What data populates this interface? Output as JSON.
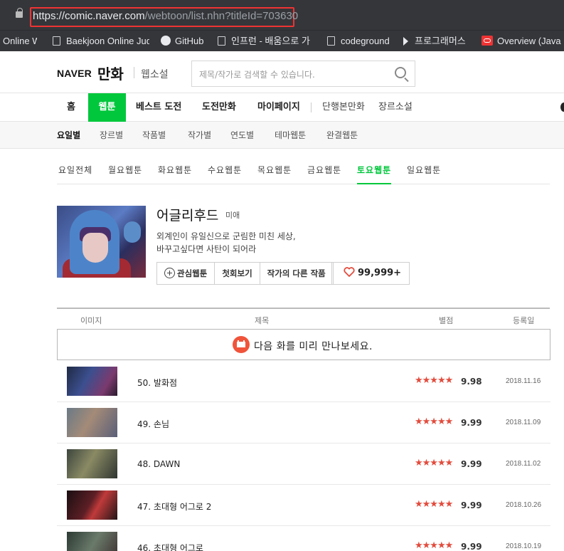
{
  "browser": {
    "url_prefix": "https://comic.naver.com",
    "url_rest": "/webtoon/list.nhn?titleId=703630",
    "bookmarks": [
      {
        "label": "Online W",
        "icon": "none"
      },
      {
        "label": "Baekjoon Online Jud",
        "icon": "page-icon"
      },
      {
        "label": "GitHub",
        "icon": "github-icon"
      },
      {
        "label": "인프런 - 배움으로 가",
        "icon": "page-icon"
      },
      {
        "label": "codeground",
        "icon": "page-icon"
      },
      {
        "label": "프로그래머스",
        "icon": "programmers-icon"
      },
      {
        "label": "Overview (Java P",
        "icon": "oracle-icon"
      }
    ]
  },
  "header": {
    "brand": "NAVER",
    "service": "만화",
    "sub_service": "웹소설",
    "search_placeholder": "제목/작가로 검색할 수 있습니다."
  },
  "gnb": {
    "items": [
      "홈",
      "웹툰",
      "베스트 도전",
      "도전만화",
      "마이페이지",
      "단행본만화",
      "장르소설"
    ],
    "active": "웹툰"
  },
  "snb": {
    "items": [
      "요일별",
      "장르별",
      "작품별",
      "작가별",
      "연도별",
      "테마웹툰",
      "완결웹툰"
    ],
    "active": "요일별"
  },
  "days": {
    "items": [
      "요일전체",
      "월요웹툰",
      "화요웹툰",
      "수요웹툰",
      "목요웹툰",
      "금요웹툰",
      "토요웹툰",
      "일요웹툰"
    ],
    "active": "토요웹툰"
  },
  "webtoon": {
    "title": "어글리후드",
    "author": "미애",
    "description_line1": "외계인이 유일신으로 군림한 미친 세상,",
    "description_line2": "바꾸고싶다면 사탄이 되어라",
    "buttons": [
      "관심웹툰",
      "첫회보기",
      "작가의 다른 작품"
    ],
    "likes": "99,999+"
  },
  "list": {
    "headers": {
      "image": "이미지",
      "title": "제목",
      "rating": "별점",
      "date": "등록일"
    },
    "preview_text": "다음 화를 미리 만나보세요.",
    "stars": "★★★★★",
    "episodes": [
      {
        "title": "50. 발화점",
        "score": "9.98",
        "date": "2018.11.16"
      },
      {
        "title": "49. 손님",
        "score": "9.99",
        "date": "2018.11.09"
      },
      {
        "title": "48. DAWN",
        "score": "9.99",
        "date": "2018.11.02"
      },
      {
        "title": "47. 초대형 어그로 2",
        "score": "9.99",
        "date": "2018.10.26"
      },
      {
        "title": "46. 초대형 어그로",
        "score": "9.99",
        "date": "2018.10.19"
      }
    ]
  },
  "colors": {
    "naver_green": "#00c73c",
    "star_red": "#e24c3d",
    "annotation_red": "#e33333"
  }
}
